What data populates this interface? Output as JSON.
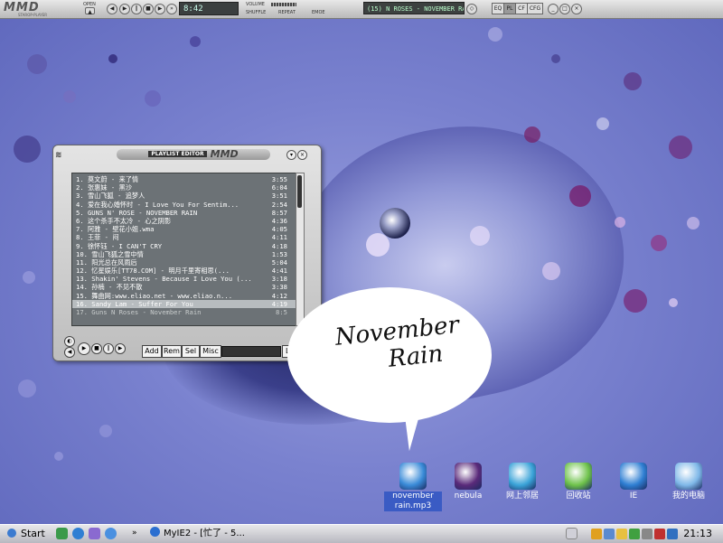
{
  "player_bar": {
    "logo": "MMD",
    "logo_sub": "STAROP-PLAYER",
    "open_label": "OPEN",
    "lcd_text": "8:42",
    "volume_label": "VOLUME",
    "shuffle_label": "SHUFFLE",
    "repeat_label": "REPEAT",
    "eq_label": "EMOE",
    "marquee": "(15) N ROSES - NOVEMBER RAIN (8:5",
    "right_buttons": [
      "EQ",
      "PL",
      "CF",
      "CFG"
    ]
  },
  "playlist": {
    "title_tag": "PLAYLIST EDITOR",
    "title_logo": "MMD",
    "items": [
      {
        "title": "1.  莫文蔚 - 来了情",
        "dur": "3:55"
      },
      {
        "title": "2.  张惠妹 - 黑沙",
        "dur": "6:04"
      },
      {
        "title": "3.  雪山飞狐 - 追梦人",
        "dur": "3:51"
      },
      {
        "title": "4.  爱在我心婚怀时 - I Love You For Sentim...",
        "dur": "2:54"
      },
      {
        "title": "5.  GUNS N' ROSE - NOVEMBER RAIN",
        "dur": "8:57"
      },
      {
        "title": "6.  这个杀手不太冷 - 心之阴影",
        "dur": "4:36"
      },
      {
        "title": "7.  阿雅 - 壁花小姐.wma",
        "dur": "4:05"
      },
      {
        "title": "8.  王菲 - 闷",
        "dur": "4:11"
      },
      {
        "title": "9.  徐怀钰 - I CAN'T CRY",
        "dur": "4:18"
      },
      {
        "title": "10. 雪山飞狐之雪中情",
        "dur": "1:53"
      },
      {
        "title": "11. 阳光总在风雨后",
        "dur": "5:04"
      },
      {
        "title": "12. 忆星娱乐[TT78.COM] - 明月千里寄相思(...",
        "dur": "4:41"
      },
      {
        "title": "13. Shakin' Stevens - Because I Love You (...",
        "dur": "3:18"
      },
      {
        "title": "14. 孙楠 - 不见不散",
        "dur": "3:38"
      },
      {
        "title": "15. 舞曲网:www.eliao.net - www.eliao.n...",
        "dur": "4:12"
      },
      {
        "title": "16. Sandy Lam - Suffer For You",
        "dur": "4:19"
      },
      {
        "title": "17. Guns N Roses - November Rain",
        "dur": "8:5"
      }
    ],
    "selected_index": 15,
    "buttons": {
      "add": "Add",
      "rem": "Rem",
      "sel": "Sel",
      "misc": "Misc",
      "list": "List"
    }
  },
  "bubble": {
    "line1": "November",
    "line2": "Rain"
  },
  "desktop_icons": [
    {
      "label": "november rain.mp3",
      "icon": "mp3-file-icon",
      "color": "#3a8bd8"
    },
    {
      "label": "nebula",
      "icon": "nebula-shortcut-icon",
      "color": "#5a2a7a"
    },
    {
      "label": "网上邻居",
      "icon": "network-places-icon",
      "color": "#3aa3d8"
    },
    {
      "label": "回收站",
      "icon": "recycle-bin-icon",
      "color": "#6ec24a"
    },
    {
      "label": "IE",
      "icon": "internet-explorer-icon",
      "color": "#2f7fd3"
    },
    {
      "label": "我的电脑",
      "icon": "my-computer-icon",
      "color": "#7fb8e8"
    }
  ],
  "taskbar": {
    "start_label": "Start",
    "task_label": "MyIE2 - [忙了 - 5...",
    "clock": "21:13"
  }
}
